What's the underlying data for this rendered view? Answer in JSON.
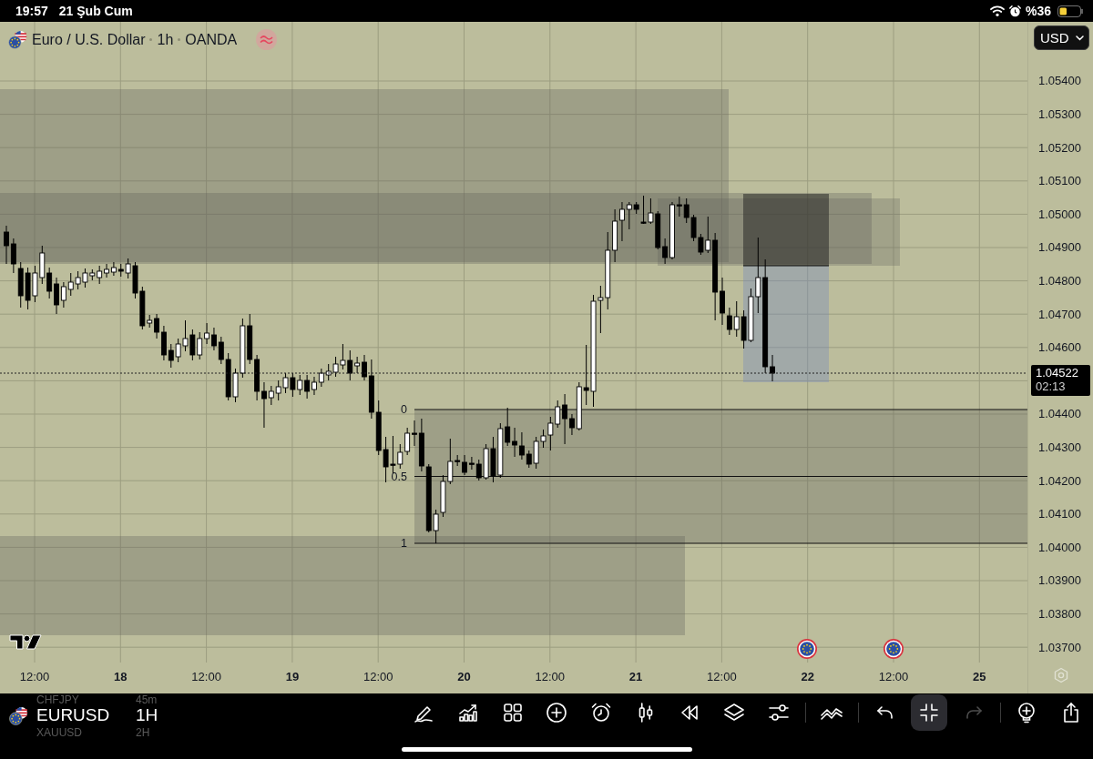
{
  "status_bar": {
    "time": "19:57",
    "date": "21 Şub Cum",
    "battery": "%36"
  },
  "chart": {
    "header": {
      "symbol": "Euro / U.S. Dollar",
      "interval": "1h",
      "exchange": "OANDA"
    },
    "currency": "USD",
    "fib_levels": [
      {
        "label": "0"
      },
      {
        "label": "0.5"
      },
      {
        "label": "1"
      }
    ],
    "price_axis": {
      "upper_labels": [
        "1.05400",
        "1.05300",
        "1.05200",
        "1.05100",
        "1.05000",
        "1.04900",
        "1.04800",
        "1.04700",
        "1.04600"
      ],
      "current_price": "1.04522",
      "countdown": "02:13",
      "lower_labels": [
        "1.04400",
        "1.04300",
        "1.04200",
        "1.04100",
        "1.04000",
        "1.03900",
        "1.03800",
        "1.03700"
      ]
    },
    "time_axis": {
      "labels": [
        {
          "text": "12:00",
          "kind": "time"
        },
        {
          "text": "18",
          "kind": "date"
        },
        {
          "text": "12:00",
          "kind": "time"
        },
        {
          "text": "19",
          "kind": "date"
        },
        {
          "text": "12:00",
          "kind": "time"
        },
        {
          "text": "20",
          "kind": "date"
        },
        {
          "text": "12:00",
          "kind": "time"
        },
        {
          "text": "21",
          "kind": "date"
        },
        {
          "text": "12:00",
          "kind": "time"
        },
        {
          "text": "22",
          "kind": "date"
        },
        {
          "text": "12:00",
          "kind": "time"
        },
        {
          "text": "25",
          "kind": "date"
        }
      ]
    }
  },
  "symbol_picker": {
    "items": [
      {
        "symbol": "CHFJPY",
        "interval": "45m",
        "selected": false
      },
      {
        "symbol": "EURUSD",
        "interval": "1H",
        "selected": true
      },
      {
        "symbol": "XAUUSD",
        "interval": "2H",
        "selected": false
      }
    ]
  },
  "toolbar": {
    "groups": [
      {
        "buttons": [
          {
            "selected": false,
            "disabled": false
          },
          {
            "selected": false,
            "disabled": false
          },
          {
            "selected": false,
            "disabled": false
          },
          {
            "selected": false,
            "disabled": false
          },
          {
            "selected": false,
            "disabled": false
          },
          {
            "selected": false,
            "disabled": false
          },
          {
            "selected": false,
            "disabled": false
          },
          {
            "selected": false,
            "disabled": false
          },
          {
            "selected": false,
            "disabled": false
          }
        ]
      },
      {
        "buttons": [
          {
            "selected": false,
            "disabled": false
          }
        ]
      },
      {
        "buttons": [
          {
            "selected": false,
            "disabled": false
          },
          {
            "selected": true,
            "disabled": false
          },
          {
            "selected": false,
            "disabled": true
          }
        ]
      },
      {
        "buttons": [
          {
            "selected": false,
            "disabled": false
          },
          {
            "selected": false,
            "disabled": false
          }
        ]
      }
    ]
  }
}
